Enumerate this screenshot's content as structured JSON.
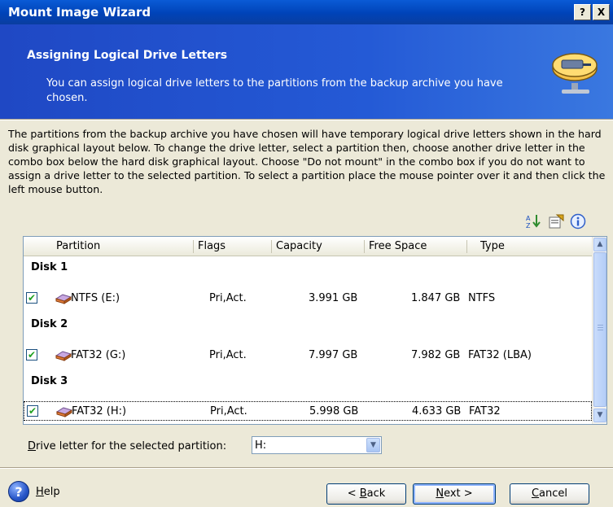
{
  "window": {
    "title": "Mount Image Wizard",
    "help_button": "?",
    "close_button": "X"
  },
  "header": {
    "title": "Assigning Logical Drive Letters",
    "subtitle": "You can assign logical drive letters to the partitions from the backup archive you have chosen."
  },
  "description": "The partitions from the backup archive you have chosen will have temporary logical drive letters shown in the hard disk graphical layout below. To change the drive letter, select a partition then, choose another drive letter in the combo box below the hard disk graphical layout. Choose \"Do not mount\" in the combo box if you do not want to assign a drive letter to the selected partition. To select a partition place the mouse pointer over it and then click the left mouse button.",
  "toolbar": {
    "icons": [
      "sort-icon",
      "properties-icon",
      "info-icon"
    ]
  },
  "table": {
    "columns": [
      "Partition",
      "Flags",
      "Capacity",
      "Free Space",
      "Type"
    ],
    "disks": [
      {
        "label": "Disk 1",
        "partition": {
          "name": "NTFS (E:)",
          "flags": "Pri,Act.",
          "capacity": "3.991 GB",
          "free": "1.847 GB",
          "type": "NTFS",
          "checked": true
        }
      },
      {
        "label": "Disk 2",
        "partition": {
          "name": "FAT32 (G:)",
          "flags": "Pri,Act.",
          "capacity": "7.997 GB",
          "free": "7.982 GB",
          "type": "FAT32 (LBA)",
          "checked": true
        }
      },
      {
        "label": "Disk 3",
        "partition": {
          "name": "FAT32 (H:)",
          "flags": "Pri,Act.",
          "capacity": "5.998 GB",
          "free": "4.633 GB",
          "type": "FAT32",
          "checked": true
        }
      }
    ]
  },
  "drive_letter": {
    "label_prefix": "D",
    "label_rest": "rive letter for the selected partition:",
    "value": "H:"
  },
  "buttons": {
    "help": {
      "u": "H",
      "rest": "elp"
    },
    "back": {
      "pre": "< ",
      "u": "B",
      "rest": "ack"
    },
    "next": {
      "u": "N",
      "rest": "ext >"
    },
    "cancel": {
      "u": "C",
      "rest": "ancel"
    }
  },
  "colors": {
    "title_bar": "#0043b8",
    "header_bg": "#245ad6",
    "dialog_bg": "#ece9d8",
    "check_green": "#21a121"
  }
}
